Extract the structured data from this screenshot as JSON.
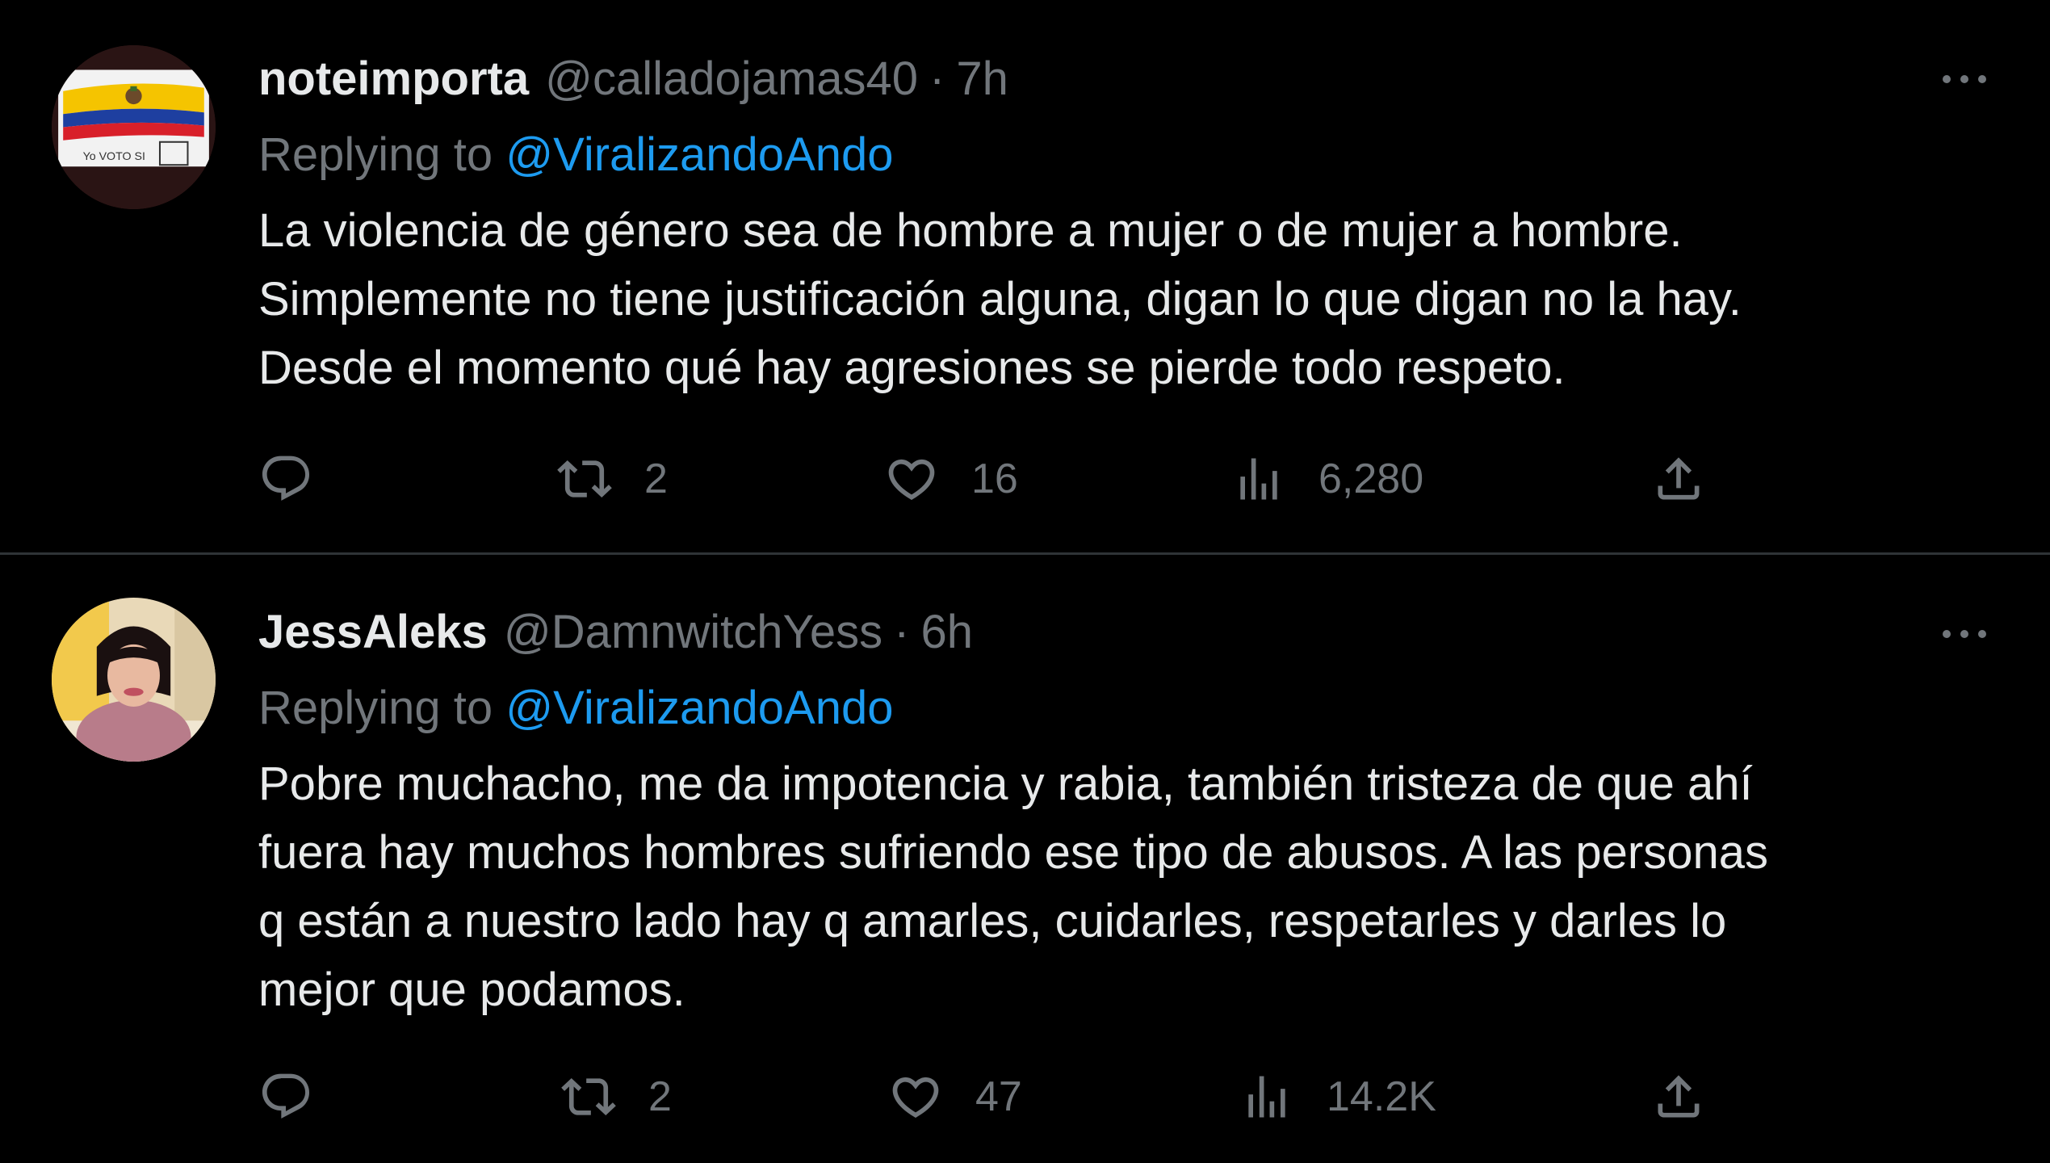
{
  "tweets": [
    {
      "display_name": "noteimporta",
      "handle": "@calladojamas40",
      "separator": "·",
      "time": "7h",
      "replying_prefix": "Replying to",
      "replying_to": "@ViralizandoAndo",
      "avatar_text": "Yo VOTO SI",
      "text": "La violencia de género sea de hombre a mujer o de mujer a hombre.\nSimplemente no tiene justificación alguna, digan lo que digan no la hay.\nDesde el momento qué hay agresiones se pierde todo respeto.",
      "reply_count": "",
      "retweet_count": "2",
      "like_count": "16",
      "view_count": "6,280"
    },
    {
      "display_name": "JessAleks",
      "handle": "@DamnwitchYess",
      "separator": "·",
      "time": "6h",
      "replying_prefix": "Replying to",
      "replying_to": "@ViralizandoAndo",
      "text": "Pobre muchacho, me da impotencia y rabia, también tristeza de que ahí\nfuera hay muchos hombres sufriendo ese tipo de abusos. A las personas\nq están a nuestro lado hay q amarles, cuidarles, respetarles y darles lo\nmejor que podamos.",
      "reply_count": "",
      "retweet_count": "2",
      "like_count": "47",
      "view_count": "14.2K"
    }
  ],
  "icons": {
    "reply": "reply-icon",
    "retweet": "retweet-icon",
    "like": "heart-icon",
    "views": "views-icon",
    "share": "share-icon",
    "more": "more-icon"
  },
  "colors": {
    "background": "#000000",
    "text": "#e7e9ea",
    "muted": "#71767b",
    "link": "#1d9bf0",
    "divider": "#2f3336"
  }
}
